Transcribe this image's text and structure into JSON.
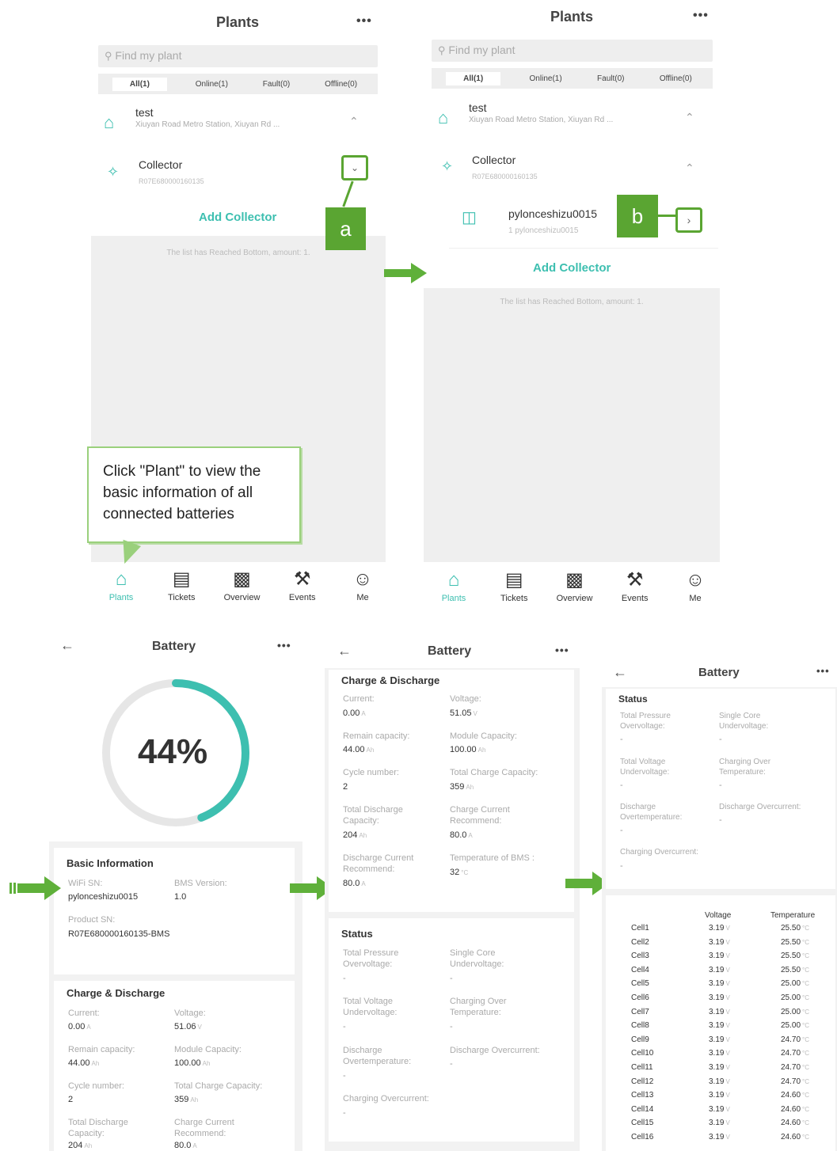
{
  "plants_screens": [
    {
      "title": "Plants",
      "more": "•••",
      "search_placeholder": "Find my plant",
      "tabs": [
        "All(1)",
        "Online(1)",
        "Fault(0)",
        "Offline(0)"
      ],
      "plant": {
        "name": "test",
        "address": "Xiuyan Road Metro Station, Xiuyan Rd ..."
      },
      "collector": {
        "label": "Collector",
        "sn": "R07E680000160135"
      },
      "add_collector": "Add Collector",
      "list_bottom": "The list has Reached Bottom, amount: 1."
    },
    {
      "title": "Plants",
      "more": "•••",
      "search_placeholder": "Find my plant",
      "tabs": [
        "All(1)",
        "Online(1)",
        "Fault(0)",
        "Offline(0)"
      ],
      "plant": {
        "name": "test",
        "address": "Xiuyan Road Metro Station, Xiuyan Rd ..."
      },
      "collector": {
        "label": "Collector",
        "sn": "R07E680000160135"
      },
      "device": {
        "name": "pylonceshizu0015",
        "sub": "1 pylonceshizu0015"
      },
      "add_collector": "Add Collector",
      "list_bottom": "The list has Reached Bottom, amount: 1."
    }
  ],
  "nav": [
    "Plants",
    "Tickets",
    "Overview",
    "Events",
    "Me"
  ],
  "markers": {
    "a": "a",
    "b": "b"
  },
  "callout": "Click \"Plant\" to view the basic information of all connected batteries",
  "battery_title": "Battery",
  "soc": {
    "label": "44%",
    "value": 0.44
  },
  "basic_info": {
    "title": "Basic Information",
    "wifi_sn_label": "WiFi SN:",
    "wifi_sn": "pylonceshizu0015",
    "bms_version_label": "BMS Version:",
    "bms_version": "1.0",
    "product_sn_label": "Product SN:",
    "product_sn": "R07E680000160135-BMS"
  },
  "charge_discharge": {
    "title": "Charge & Discharge",
    "current_label": "Current:",
    "current": "0.00",
    "current_unit": "A",
    "voltage_label": "Voltage:",
    "voltage_s4": "51.06",
    "voltage_s5": "51.05",
    "voltage_unit": "V",
    "remain_label": "Remain capacity:",
    "remain": "44.00",
    "ah": "Ah",
    "module_label": "Module Capacity:",
    "module": "100.00",
    "cycle_label": "Cycle number:",
    "cycle": "2",
    "total_charge_label": "Total Charge Capacity:",
    "total_charge": "359",
    "total_discharge_label": "Total Discharge Capacity:",
    "total_discharge": "204",
    "charge_rec_label": "Charge Current Recommend:",
    "charge_rec": "80.0",
    "discharge_rec_label": "Discharge Current Recommend:",
    "discharge_rec": "80.0",
    "temp_bms_label": "Temperature of BMS :",
    "temp_bms": "32",
    "temp_unit": "°C"
  },
  "status": {
    "title": "Status",
    "items": [
      "Total Pressure Overvoltage:",
      "Single Core Undervoltage:",
      "Total Voltage Undervoltage:",
      "Charging Over Temperature:",
      "Discharge Overtemperature:",
      "Discharge Overcurrent:",
      "Charging Overcurrent:"
    ],
    "dash": "-"
  },
  "cells": {
    "voltage_header": "Voltage",
    "temp_header": "Temperature",
    "v_unit": "V",
    "t_unit": "°C",
    "rows": [
      [
        "Cell1",
        "3.19",
        "25.50"
      ],
      [
        "Cell2",
        "3.19",
        "25.50"
      ],
      [
        "Cell3",
        "3.19",
        "25.50"
      ],
      [
        "Cell4",
        "3.19",
        "25.50"
      ],
      [
        "Cell5",
        "3.19",
        "25.00"
      ],
      [
        "Cell6",
        "3.19",
        "25.00"
      ],
      [
        "Cell7",
        "3.19",
        "25.00"
      ],
      [
        "Cell8",
        "3.19",
        "25.00"
      ],
      [
        "Cell9",
        "3.19",
        "24.70"
      ],
      [
        "Cell10",
        "3.19",
        "24.70"
      ],
      [
        "Cell11",
        "3.19",
        "24.70"
      ],
      [
        "Cell12",
        "3.19",
        "24.70"
      ],
      [
        "Cell13",
        "3.19",
        "24.60"
      ],
      [
        "Cell14",
        "3.19",
        "24.60"
      ],
      [
        "Cell15",
        "3.19",
        "24.60"
      ],
      [
        "Cell16",
        "3.19",
        "24.60"
      ]
    ]
  },
  "colors": {
    "accent": "#3dbfb0",
    "marker_green": "#5aa532",
    "arrow_green": "#5fb03a"
  }
}
